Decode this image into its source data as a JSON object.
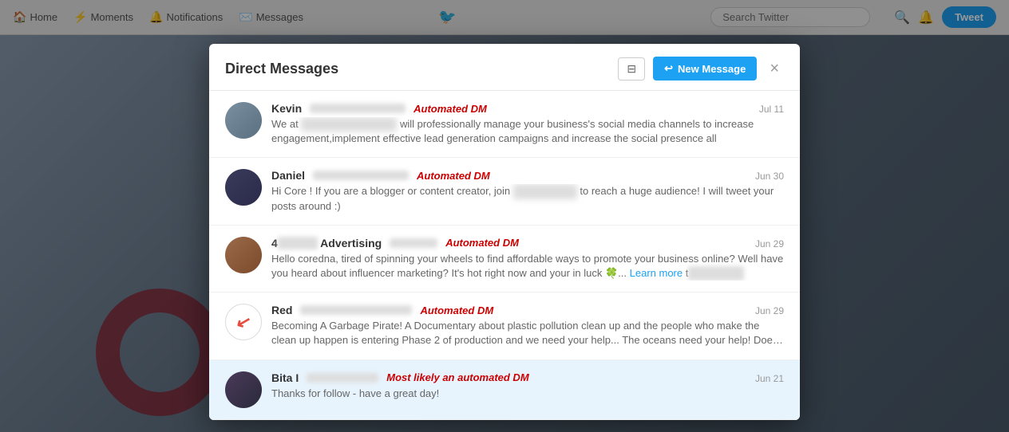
{
  "topbar": {
    "items": [
      {
        "label": "Home",
        "icon": "🏠"
      },
      {
        "label": "Moments",
        "icon": "⚡"
      },
      {
        "label": "Notifications",
        "icon": "🔔"
      },
      {
        "label": "Messages",
        "icon": "✉️"
      }
    ],
    "search_placeholder": "Search Twitter",
    "tweet_label": "Tweet"
  },
  "modal": {
    "title": "Direct Messages",
    "new_message_label": "New Message",
    "close_label": "×",
    "filter_icon": "▼"
  },
  "messages": [
    {
      "id": "kevin",
      "sender_name": "Kevin",
      "date": "Jul 11",
      "automated_label": "Automated DM",
      "preview": "We at [redacted] will professionally manage your business's social media channels to increase engagement,implement effective lead generation campaigns and increase the social presence all",
      "avatar_class": "avatar-kevin",
      "highlighted": false
    },
    {
      "id": "daniel",
      "sender_name": "Daniel",
      "date": "Jun 30",
      "automated_label": "Automated DM",
      "preview": "Hi Core ! If you are a blogger or content creator, join [redacted] to reach a huge audience! I will tweet your posts around :)",
      "avatar_class": "avatar-daniel",
      "highlighted": false
    },
    {
      "id": "advertising",
      "sender_name": "4[redacted] Advertising",
      "date": "Jun 29",
      "automated_label": "Automated DM",
      "preview": "Hello coredna, tired of spinning your wheels to find affordable ways to promote your business online? Well have you heard about influencer marketing? It's hot right now and your in luck 🍀... Learn more t[redacted]",
      "avatar_class": "avatar-advertising",
      "highlighted": false
    },
    {
      "id": "red",
      "sender_name": "Red",
      "date": "Jun 29",
      "automated_label": "Automated DM",
      "preview": "Becoming A Garbage Pirate! A Documentary about plastic pollution clean up and the people who make the clean up happen is entering Phase 2 of production and we need your help... The oceans need your help! Does the health and",
      "avatar_class": "avatar-red",
      "highlighted": false
    },
    {
      "id": "bita",
      "sender_name": "Bita I[redacted]",
      "date": "Jun 21",
      "automated_label": "Most likely an automated DM",
      "preview": "Thanks for follow - have a great day!",
      "avatar_class": "avatar-bita",
      "highlighted": true
    }
  ]
}
